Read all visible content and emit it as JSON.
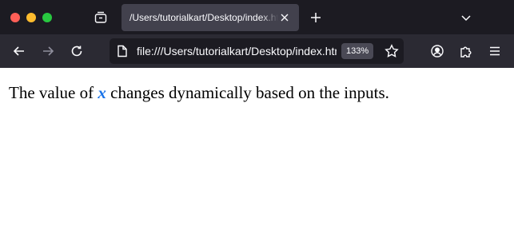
{
  "browser": {
    "tab": {
      "title": "/Users/tutorialkart/Desktop/index.html"
    },
    "address_bar": {
      "url": "file:///Users/tutorialkart/Desktop/index.html",
      "zoom": "133%"
    },
    "icons": [
      "tab-overview-icon",
      "close-icon",
      "plus-icon",
      "chevron-down-icon",
      "back-arrow-icon",
      "forward-arrow-icon",
      "reload-icon",
      "page-icon",
      "star-icon",
      "account-icon",
      "extensions-icon",
      "menu-icon"
    ]
  },
  "page": {
    "text_before": "The value of ",
    "variable": "x",
    "text_after": " changes dynamically based on the inputs."
  },
  "colors": {
    "titlebar": "#1c1b22",
    "toolbar": "#2b2a33",
    "active_tab": "#42414d",
    "variable": "#1a73e8"
  }
}
